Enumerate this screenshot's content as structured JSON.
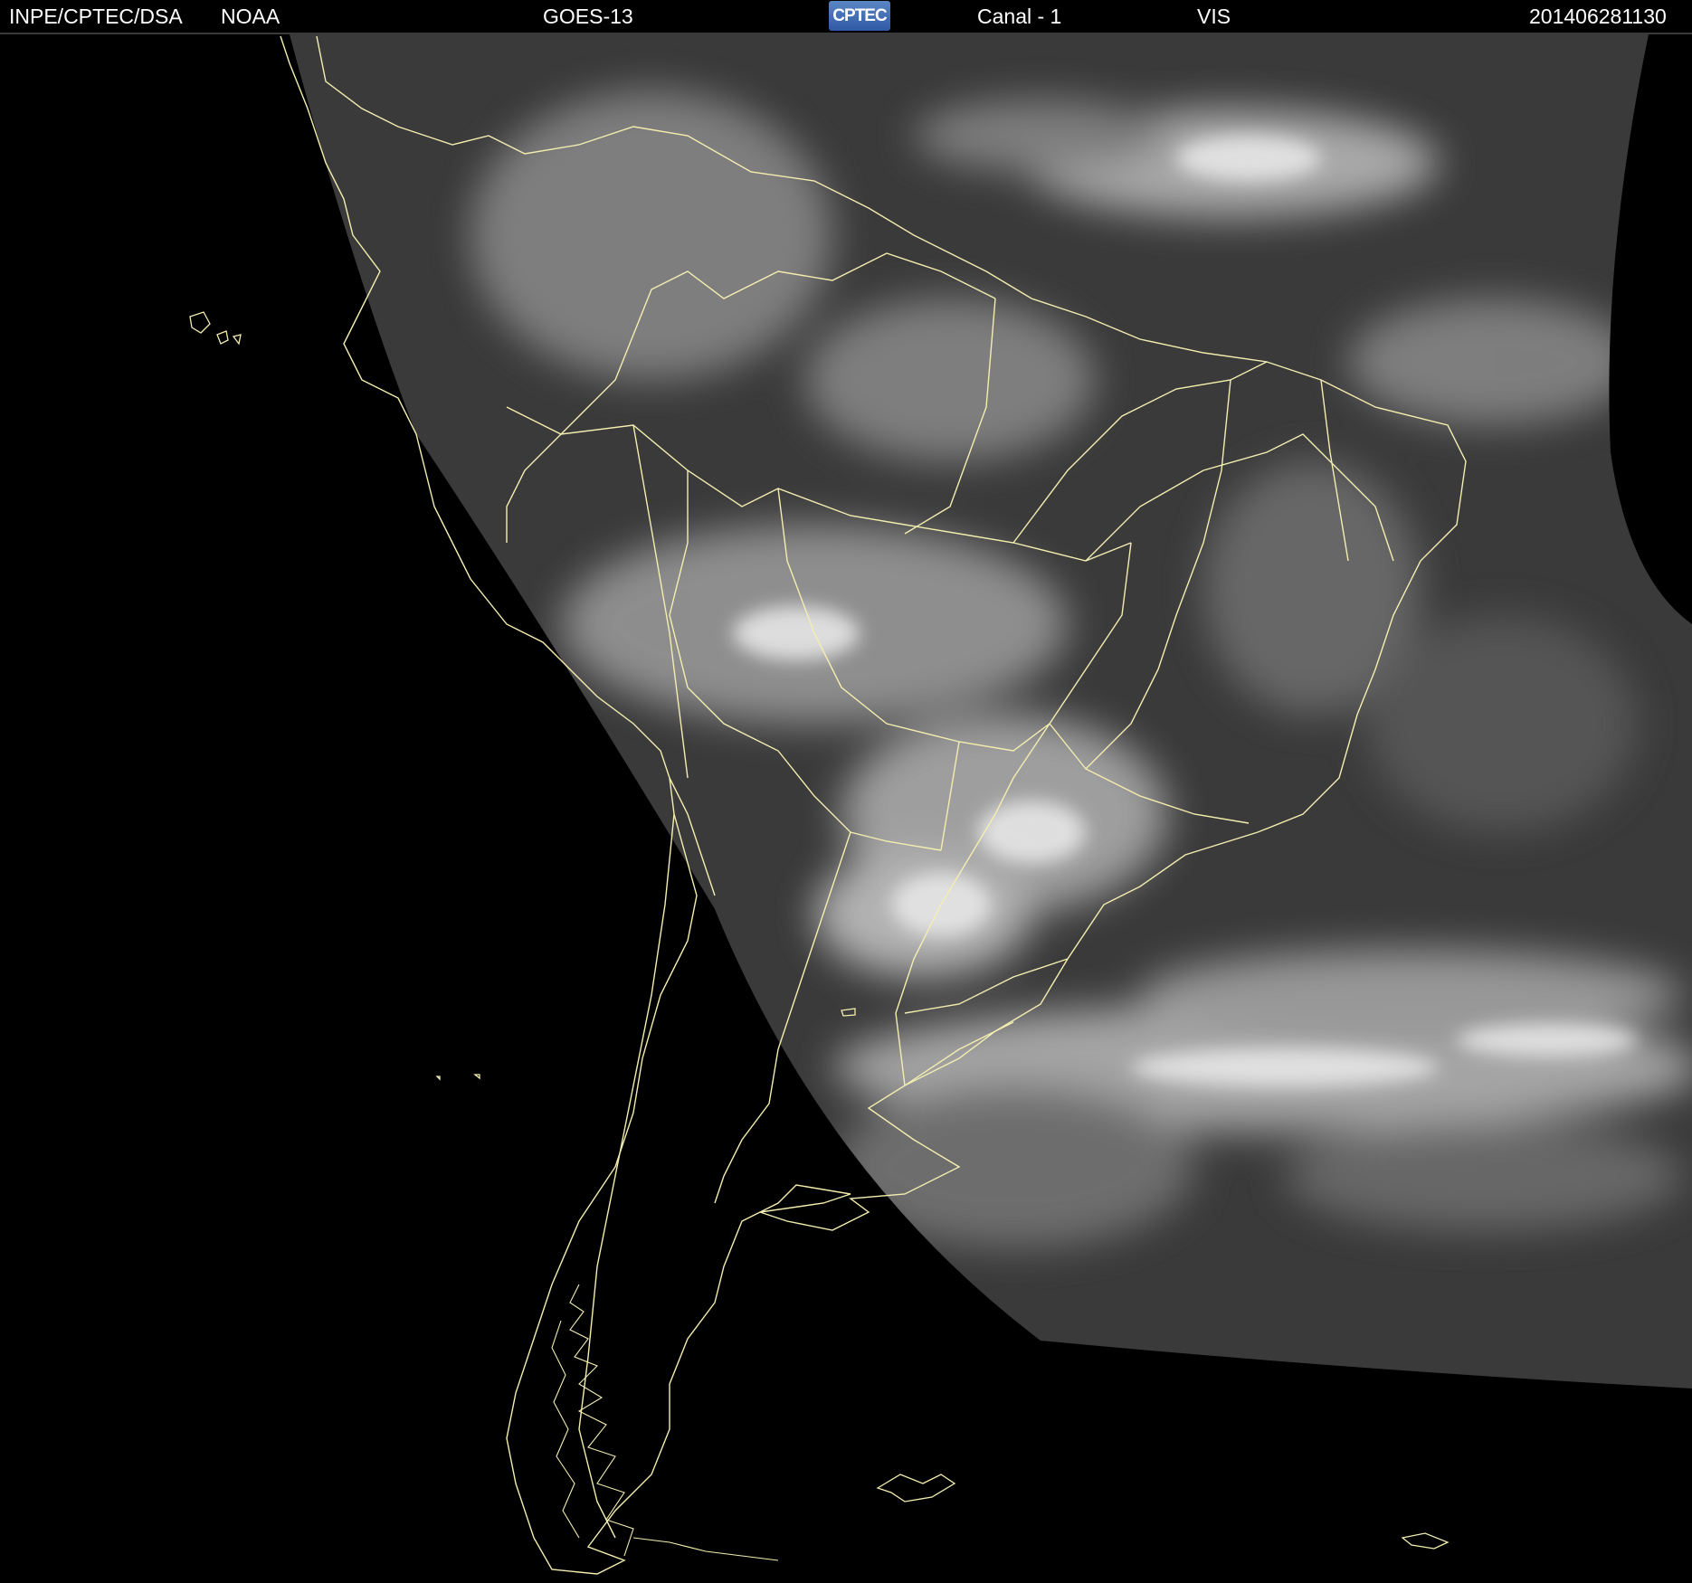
{
  "header": {
    "org": "INPE/CPTEC/DSA",
    "agency": "NOAA",
    "satellite": "GOES-13",
    "logo_text": "CPTEC",
    "channel": "Canal - 1",
    "band": "VIS",
    "timestamp": "201406281130"
  },
  "colors": {
    "background": "#000000",
    "coastline": "#f3eeb0",
    "cloud": "#d8d8d8",
    "land_ocean_gray": "#3c3c3c",
    "logo_blue": "#3f6bb5"
  },
  "icons": [
    "cptec-logo"
  ]
}
